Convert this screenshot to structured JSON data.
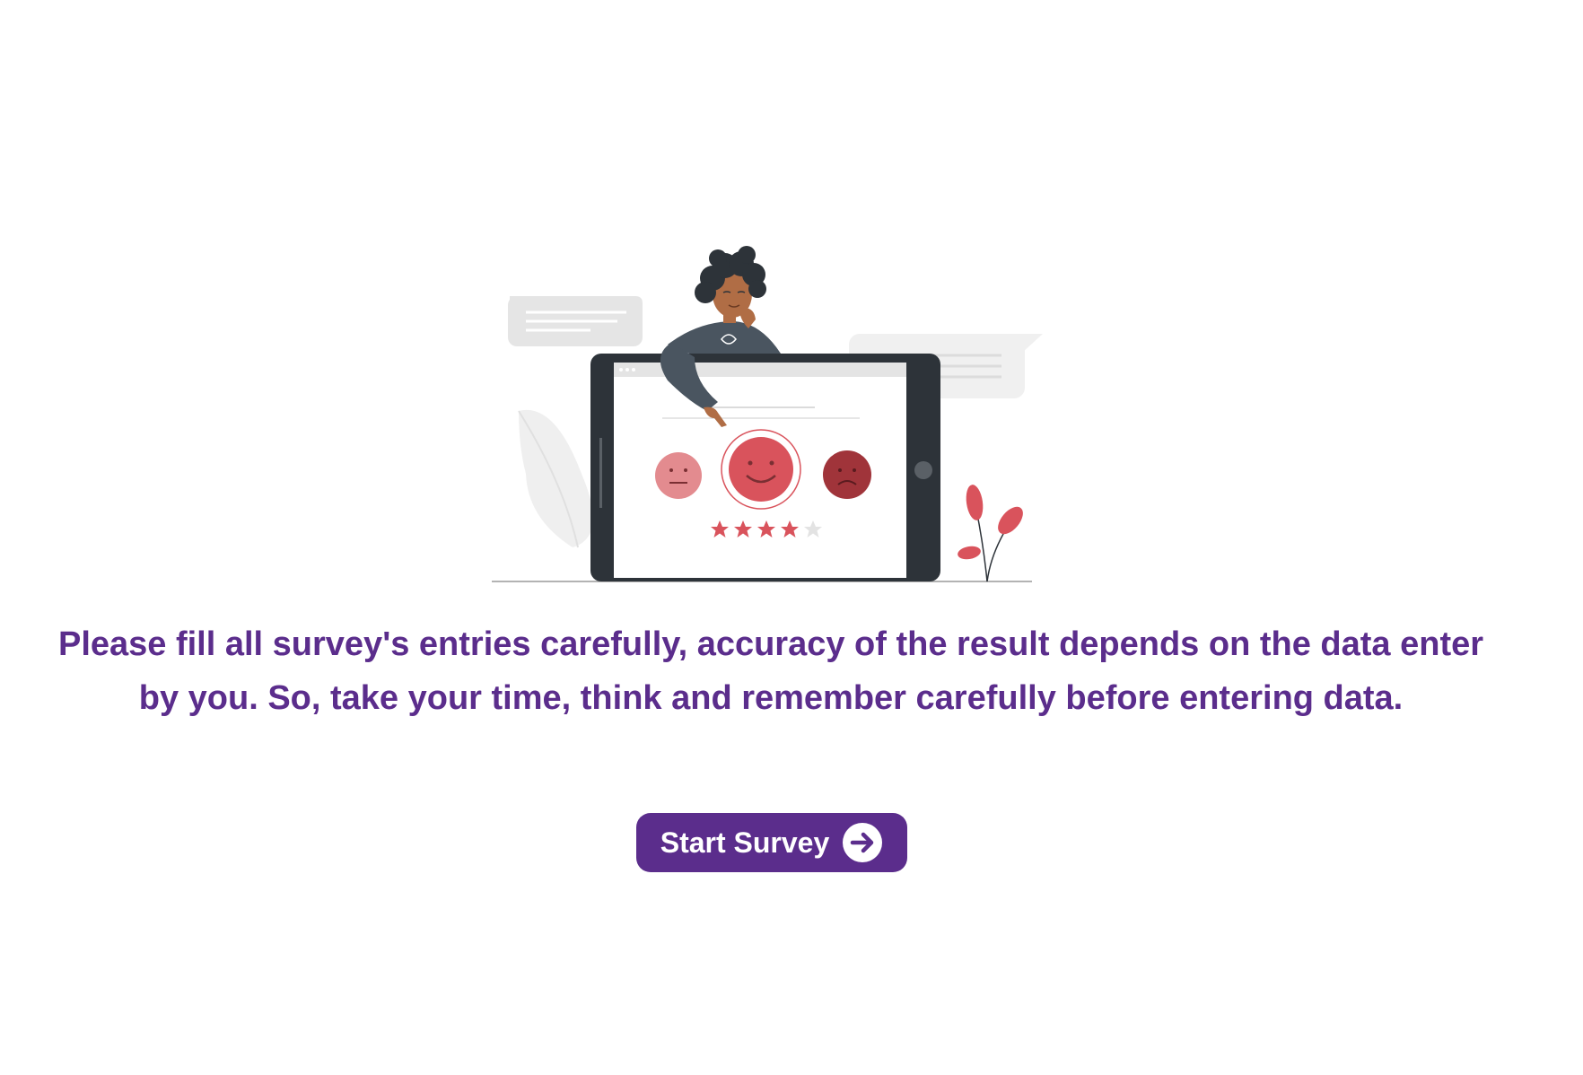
{
  "intro": {
    "message": "Please fill all survey's entries carefully, accuracy of the result depends on the data enter by you. So, take your time, think and remember carefully before entering data.",
    "start_button_label": "Start Survey"
  },
  "illustration": {
    "rating_stars_filled": 4,
    "rating_stars_total": 5,
    "colors": {
      "accent": "#5b2d8c",
      "face_light": "#e38b8f",
      "face_main": "#d9535c",
      "face_dark": "#a0343a",
      "tablet": "#2d3339",
      "bubble": "#e5e5e5",
      "leaf_gray": "#ececec",
      "plant": "#d9535c"
    }
  }
}
